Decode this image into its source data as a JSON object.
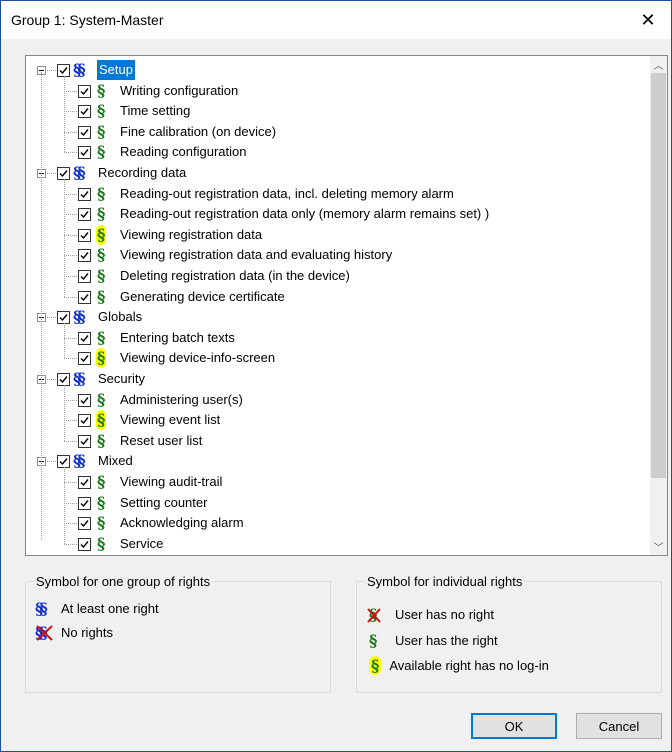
{
  "window": {
    "title": "Group 1: System-Master",
    "close_glyph": "✕"
  },
  "tree": {
    "groups": [
      {
        "label": "Setup",
        "selected": true,
        "items": [
          {
            "label": "Writing configuration",
            "highlight": false
          },
          {
            "label": "Time setting",
            "highlight": false
          },
          {
            "label": "Fine calibration (on device)",
            "highlight": false
          },
          {
            "label": "Reading configuration",
            "highlight": false
          }
        ]
      },
      {
        "label": "Recording data",
        "selected": false,
        "items": [
          {
            "label": "Reading-out registration data, incl. deleting memory alarm",
            "highlight": false
          },
          {
            "label": "Reading-out registration data only (memory alarm remains set) )",
            "highlight": false
          },
          {
            "label": "Viewing registration data",
            "highlight": true
          },
          {
            "label": "Viewing registration data and evaluating history",
            "highlight": false
          },
          {
            "label": "Deleting registration data (in the device)",
            "highlight": false
          },
          {
            "label": "Generating device certificate",
            "highlight": false
          }
        ]
      },
      {
        "label": "Globals",
        "selected": false,
        "items": [
          {
            "label": "Entering batch texts",
            "highlight": false
          },
          {
            "label": "Viewing device-info-screen",
            "highlight": true
          }
        ]
      },
      {
        "label": "Security",
        "selected": false,
        "items": [
          {
            "label": "Administering user(s)",
            "highlight": false
          },
          {
            "label": "Viewing event list",
            "highlight": true
          },
          {
            "label": "Reset user list",
            "highlight": false
          }
        ]
      },
      {
        "label": "Mixed",
        "selected": false,
        "items": [
          {
            "label": "Viewing audit-trail",
            "highlight": false
          },
          {
            "label": "Setting counter",
            "highlight": false
          },
          {
            "label": "Acknowledging alarm",
            "highlight": false
          },
          {
            "label": "Service",
            "highlight": false
          }
        ]
      }
    ],
    "group_symbol": "§§",
    "item_symbol": "§"
  },
  "legend_group": {
    "title": "Symbol for one group of rights",
    "at_least_one": "At least one right",
    "no_rights": "No rights"
  },
  "legend_individual": {
    "title": "Symbol for individual rights",
    "no_right": "User has no right",
    "has_right": "User has the right",
    "no_login": "Available right has no log-in"
  },
  "buttons": {
    "ok": "OK",
    "cancel": "Cancel"
  },
  "colors": {
    "group_symbol": "#1030d0",
    "item_symbol": "#1a7a1a",
    "highlight": "#ffff00",
    "selection": "#0078d7",
    "no_right_cross": "#d01010"
  },
  "icons": {
    "expander": "minus-box-icon",
    "checkbox": "checkbox-checked-icon",
    "scroll_up": "chevron-up-icon",
    "scroll_down": "chevron-down-icon"
  }
}
